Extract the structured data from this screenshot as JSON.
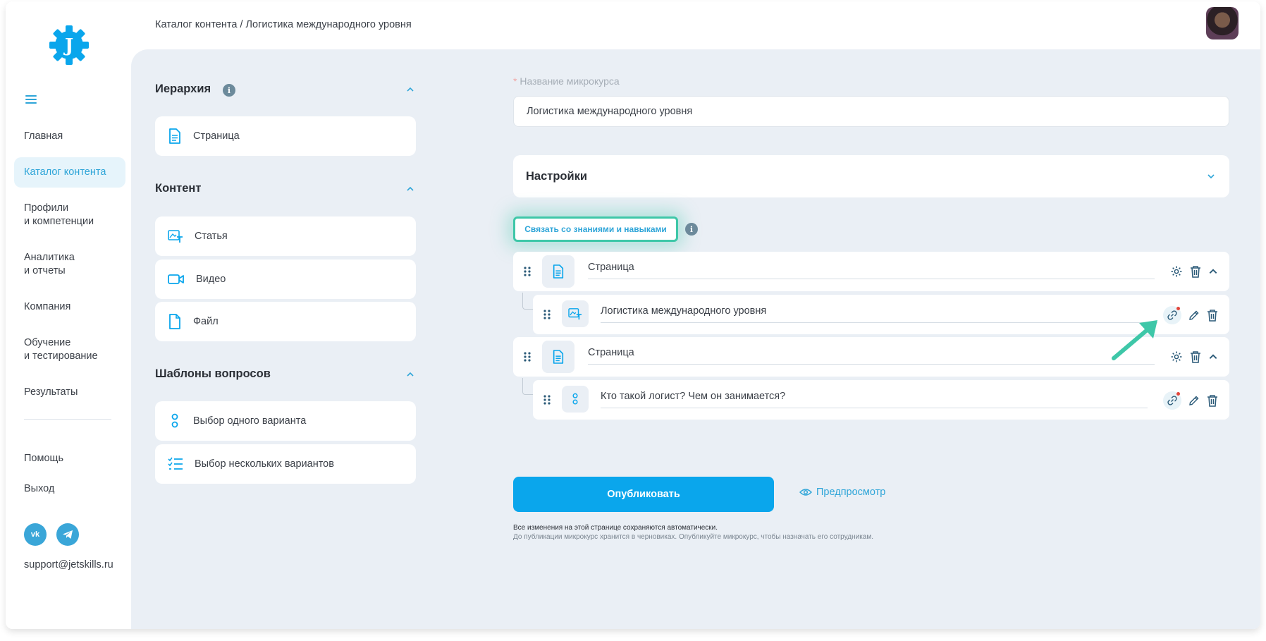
{
  "breadcrumb": "Каталог контента / Логистика международного уровня",
  "logo_letter": "J",
  "sidebar": {
    "items": [
      {
        "label": "Главная"
      },
      {
        "label": "Каталог контента",
        "active": true
      },
      {
        "label": "Профили\nи компетенции"
      },
      {
        "label": "Аналитика\nи отчеты"
      },
      {
        "label": "Компания"
      },
      {
        "label": "Обучение\nи тестирование"
      },
      {
        "label": "Результаты"
      }
    ],
    "help": "Помощь",
    "logout": "Выход",
    "vk": "vk",
    "support_email": "support@jetskills.ru"
  },
  "left_panel": {
    "hierarchy": {
      "title": "Иерархия",
      "items": [
        "Страница"
      ]
    },
    "content": {
      "title": "Контент",
      "items": [
        "Статья",
        "Видео",
        "Файл"
      ]
    },
    "question_templates": {
      "title": "Шаблоны вопросов",
      "items": [
        "Выбор одного варианта",
        "Выбор нескольких вариантов"
      ]
    }
  },
  "form": {
    "name_label_required": "*",
    "name_label": "Название микрокурса",
    "name_value": "Логистика международного уровня",
    "settings_title": "Настройки",
    "link_button": "Связать со знаниями и навыками"
  },
  "structure": [
    {
      "type": "page",
      "title": "Страница",
      "children": [
        {
          "type": "article",
          "title": "Логистика международного уровня"
        }
      ]
    },
    {
      "type": "page",
      "title": "Страница",
      "children": [
        {
          "type": "question",
          "title": "Кто такой логист? Чем он занимается?"
        }
      ]
    }
  ],
  "publish_button": "Опубликовать",
  "preview_link": "Предпросмотр",
  "notes": {
    "autosave": "Все изменения на этой странице сохраняются автоматически.",
    "draft": "До публикации микрокурс хранится в черновиках. Опубликуйте микрокурс, чтобы назначать его сотрудникам."
  },
  "colors": {
    "accent": "#0aa6ec",
    "highlight": "#3ec7a8",
    "background": "#eaeff5"
  }
}
